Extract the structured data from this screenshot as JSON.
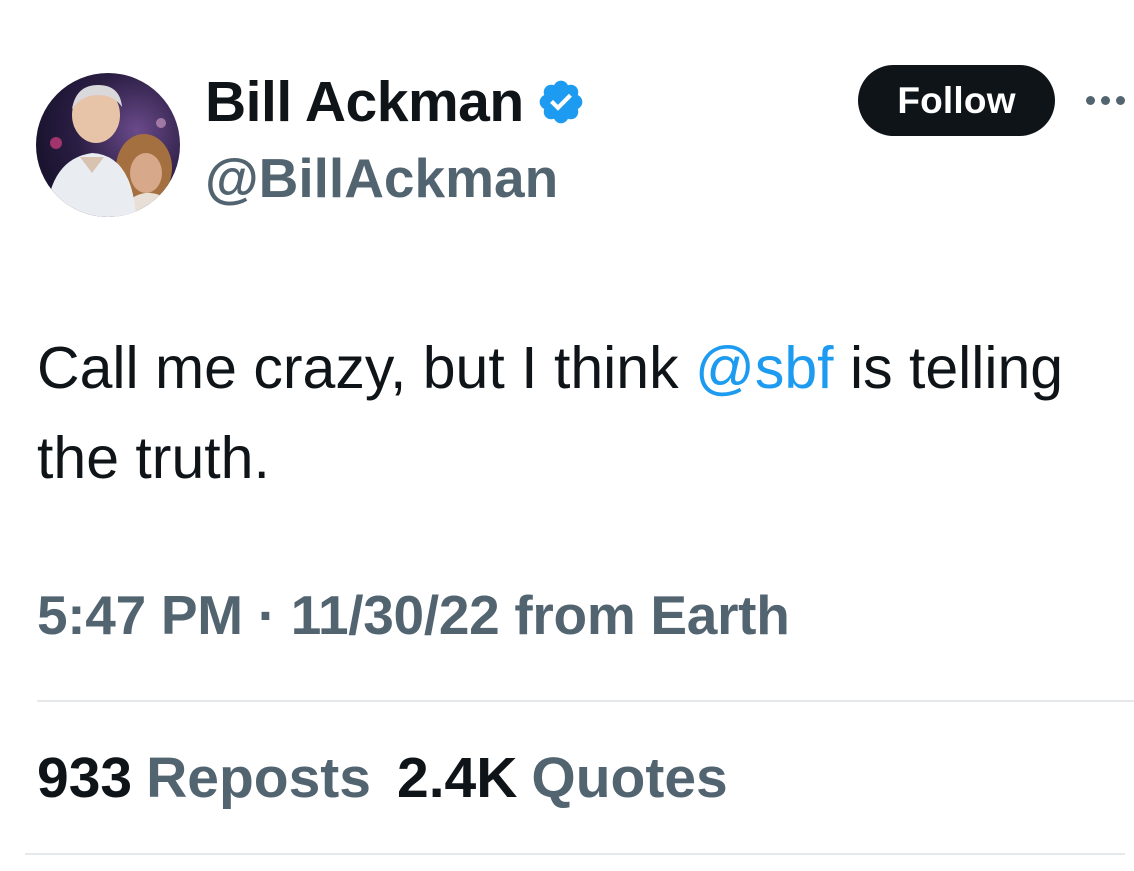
{
  "author": {
    "display_name": "Bill Ackman",
    "handle": "@BillAckman",
    "verified": true
  },
  "actions": {
    "follow_label": "Follow",
    "more_icon": "more-horizontal-icon"
  },
  "tweet": {
    "text_before": "Call me crazy, but I think ",
    "mention": "@sbf",
    "text_after": " is telling the truth."
  },
  "meta": {
    "time": "5:47 PM",
    "separator": "·",
    "date": "11/30/22",
    "source": "from Earth"
  },
  "stats": [
    {
      "count": "933",
      "label": "Reposts"
    },
    {
      "count": "2.4K",
      "label": "Quotes"
    }
  ],
  "colors": {
    "text": "#0f1419",
    "secondary": "#536471",
    "link": "#1d9bf0",
    "verified_badge": "#1d9bf0",
    "button_bg": "#0f1419",
    "divider": "#e6e9eb"
  }
}
